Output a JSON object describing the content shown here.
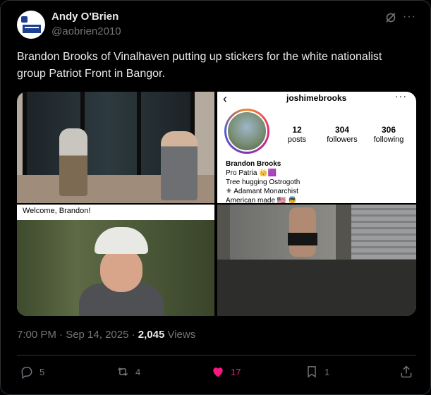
{
  "author": {
    "name": "Andy O'Brien",
    "handle": "@aobrien2010"
  },
  "icons": {
    "grok": "grok-icon",
    "more": "more-icon"
  },
  "tweet": {
    "text": "Brandon Brooks of Vinalhaven putting up stickers for the white nationalist group Patriot Front in Bangor."
  },
  "instagram": {
    "username": "joshimebrooks",
    "posts_count": "12",
    "posts_label": "posts",
    "followers_count": "304",
    "followers_label": "followers",
    "following_count": "306",
    "following_label": "following",
    "bio_name": "Brandon Brooks",
    "bio_lines": [
      "Pro Patria 👑🟪",
      "Tree hugging Ostrogoth",
      "⚜ Adamant Monarchist",
      "American made 🇺🇸 👼"
    ]
  },
  "photo_caption": "Welcome, Brandon!",
  "meta": {
    "time": "7:00 PM · Sep 14, 2025 · ",
    "views_count": "2,045",
    "views_label": " Views"
  },
  "actions": {
    "replies": "5",
    "reposts": "4",
    "likes": "17",
    "bookmarks": "1"
  },
  "colors": {
    "background": "#000000",
    "text": "#e7e9ea",
    "muted": "#71767b",
    "like": "#f91880"
  }
}
